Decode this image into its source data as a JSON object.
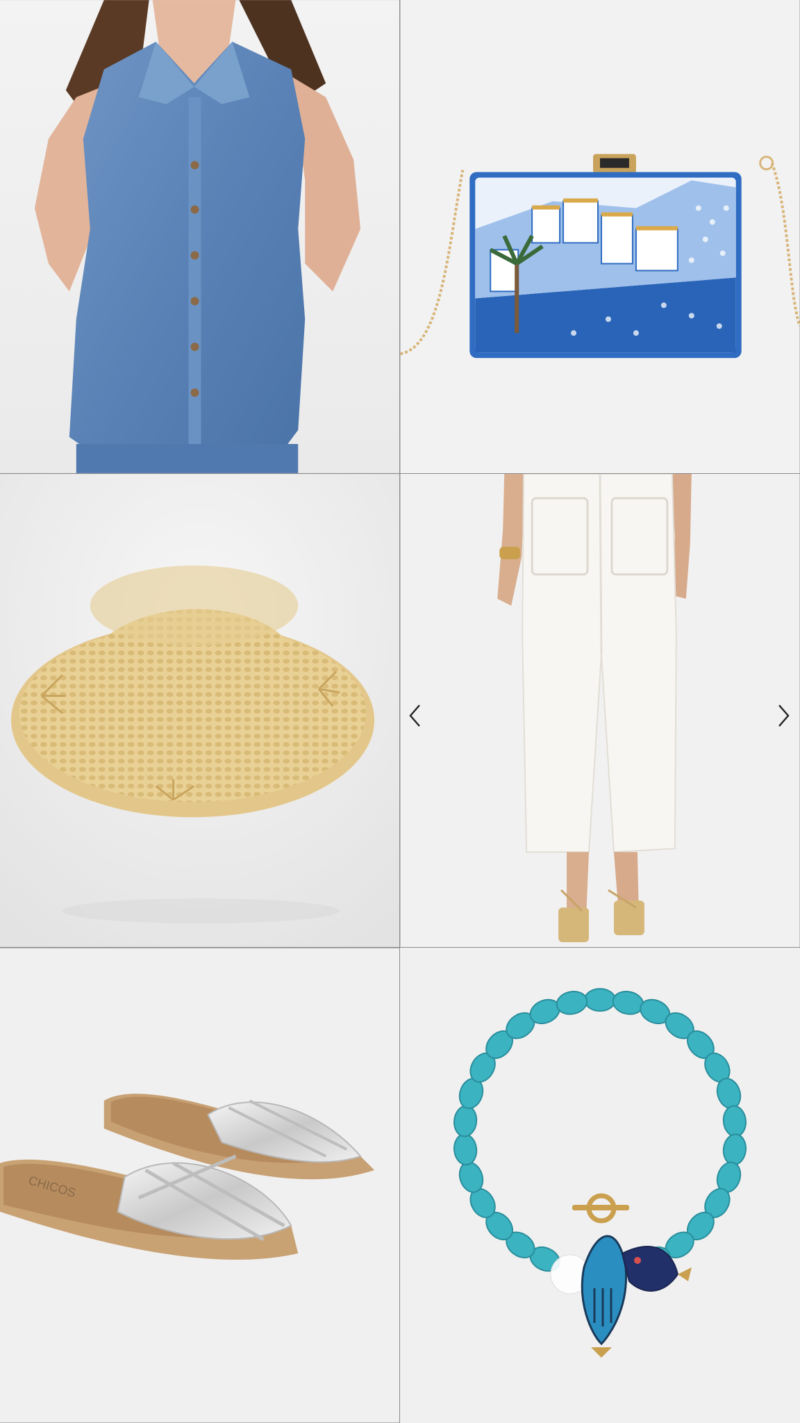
{
  "gallery": {
    "tiles": [
      {
        "name": "denim-sleeveless-shirt"
      },
      {
        "name": "embellished-clutch"
      },
      {
        "name": "straw-bucket-hat"
      },
      {
        "name": "white-cropped-pants"
      },
      {
        "name": "silver-slide-sandals"
      },
      {
        "name": "turquoise-fish-bracelet"
      }
    ],
    "sandal_brand": "CHICOS",
    "controls": {
      "prev": "chevron-left-icon",
      "next": "chevron-right-icon"
    }
  },
  "colors": {
    "denim": "#5f86b8",
    "straw": "#e6cc8e",
    "turquoise": "#3bb3c1",
    "silver": "#d7d7d7",
    "clutch_blue": "#2b6cc4",
    "pants_white": "#f5f3ef",
    "background": "#f2f2f2"
  }
}
